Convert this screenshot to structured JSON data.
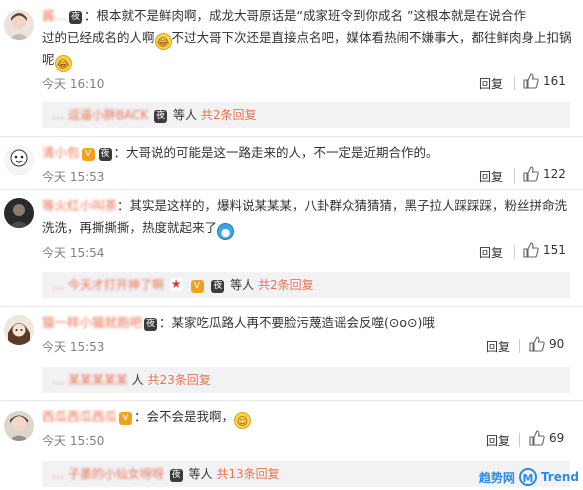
{
  "comments": [
    {
      "username": "酱…",
      "badge": "夜",
      "text_lines": [
        "：根本就不是鲜肉啊，成龙大哥原话是“成家班令到你成名 ”这根本就是在说合作",
        "过的已经成名的人啊",
        "不过大哥下次还是直接点名吧，媒体看热闹不嫌事大，都往鲜肉身上扣锅",
        "呢"
      ],
      "emoji_names": [
        "laugh-cry-emoji",
        "laugh-cry-emoji"
      ],
      "time": "今天 16:10",
      "reply_label": "回复",
      "likes": "161",
      "thread": {
        "prefix": "…",
        "badge": "夜",
        "suffix": "等人",
        "more": "共2条回复"
      }
    },
    {
      "username": "清小包",
      "badge": "夜",
      "text_lines": [
        "：大哥说的可能是这一路走来的人，不一定是近期合作的。"
      ],
      "time": "今天 15:53",
      "reply_label": "回复",
      "likes": "122"
    },
    {
      "username": "…",
      "text_lines": [
        "：其实是这样的，爆料说某某某，八卦群众猜猜猜，黑子拉人踩踩踩，粉丝拼命洗",
        "洗洗，再撕撕撕，热度就起来了"
      ],
      "emoji_names": [
        "doraemon-emoji"
      ],
      "time": "今天 15:54",
      "reply_label": "回复",
      "likes": "151",
      "thread": {
        "prefix": "…",
        "badge": "夜",
        "suffix": "等人",
        "more": "共2条回复"
      }
    },
    {
      "username": "…",
      "badge": "夜",
      "text_lines": [
        "：某家吃瓜路人再不要脸污蔑造谣会反噬(⊙o⊙)哦"
      ],
      "time": "今天 15:53",
      "reply_label": "回复",
      "likes": "90",
      "thread": {
        "prefix": "…",
        "suffix": "人",
        "more": "共23条回复"
      }
    },
    {
      "username": "…",
      "text_lines": [
        "：会不会是我啊，"
      ],
      "emoji_names": [
        "shy-emoji"
      ],
      "time": "今天 15:50",
      "reply_label": "回复",
      "likes": "69",
      "thread": {
        "prefix": "…",
        "badge": "夜",
        "suffix": "等人",
        "more": "共13条回复"
      }
    }
  ],
  "watermark": {
    "text": "趋势网",
    "logo": "M",
    "brand": "Trend"
  },
  "colors": {
    "link": "#eb7350",
    "thread_bg": "#f2f2f5",
    "muted": "#808080",
    "badge": "#3b3b3b"
  }
}
